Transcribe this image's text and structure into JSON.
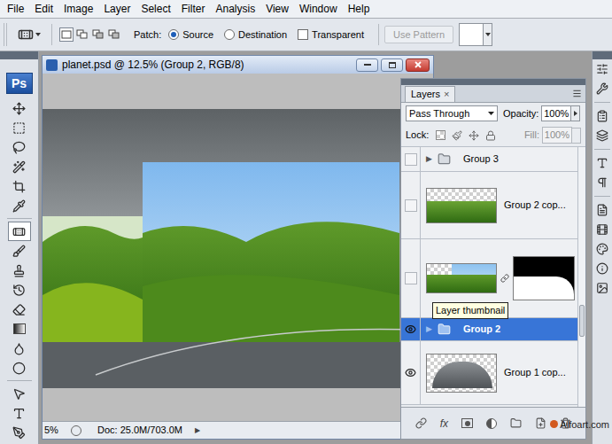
{
  "menu": [
    "File",
    "Edit",
    "Image",
    "Layer",
    "Select",
    "Filter",
    "Analysis",
    "View",
    "Window",
    "Help"
  ],
  "options_bar": {
    "selection_modes": [
      {
        "selected": true
      },
      {
        "selected": false
      },
      {
        "selected": false
      },
      {
        "selected": false
      }
    ],
    "patch_label": "Patch:",
    "patch_modes": [
      {
        "label": "Source",
        "selected": true
      },
      {
        "label": "Destination",
        "selected": false
      }
    ],
    "transparent": {
      "label": "Transparent",
      "checked": false
    },
    "use_pattern": {
      "label": "Use Pattern",
      "disabled": true
    }
  },
  "toolbar": {
    "logo": "Ps",
    "tools": [
      {
        "selected": false
      },
      {
        "selected": false
      },
      {
        "selected": false
      },
      {
        "selected": false
      },
      {
        "selected": false
      },
      {
        "selected": false
      },
      {
        "selected": true
      },
      {
        "selected": false
      },
      {
        "selected": false
      },
      {
        "selected": false
      },
      {
        "selected": false
      },
      {
        "selected": false
      },
      {
        "selected": false
      },
      {
        "selected": false
      },
      {
        "selected": false
      },
      {
        "selected": false
      },
      {
        "selected": false
      }
    ]
  },
  "document": {
    "title": "planet.psd @ 12.5% (Group 2, RGB/8)",
    "zoom": "5%",
    "doc_size": "Doc: 25.0M/703.0M",
    "status_arrow": "▶"
  },
  "layers_panel": {
    "tab": "Layers",
    "tab_close": "×",
    "blend_mode": "Pass Through",
    "opacity_label": "Opacity:",
    "opacity": "100%",
    "lock_label": "Lock:",
    "fill_label": "Fill:",
    "fill": "100%",
    "fill_disabled": true,
    "fx_label": "fx",
    "layers": [
      {
        "kind": "group",
        "arrow": "▶",
        "name": "Group 3",
        "visible": false,
        "selected": false
      },
      {
        "kind": "layer",
        "name": "Group 2 cop...",
        "visible": false,
        "selected": false
      },
      {
        "kind": "masked",
        "visible": false,
        "selected": false
      },
      {
        "kind": "group",
        "arrow": "▶",
        "name": "Group 2",
        "visible": true,
        "selected": true
      },
      {
        "kind": "layer",
        "name": "Group 1 cop...",
        "visible": true,
        "selected": false
      }
    ],
    "tooltip": "Layer thumbnail"
  },
  "watermark": "Alfoart.com"
}
